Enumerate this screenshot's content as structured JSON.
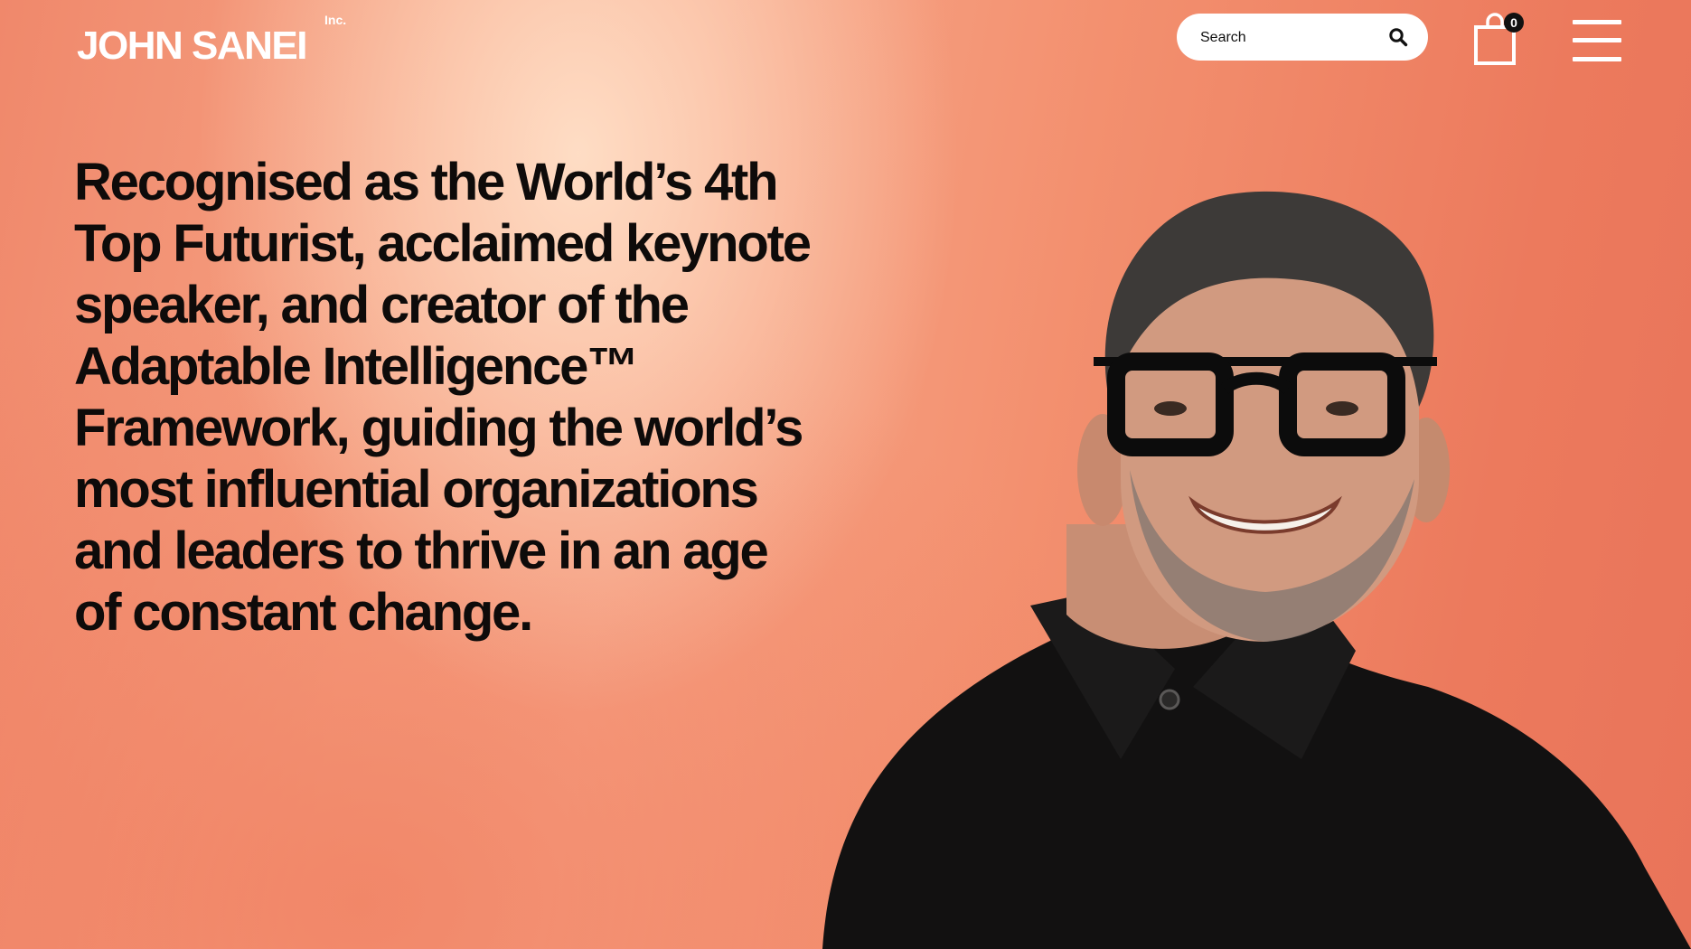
{
  "header": {
    "logo_name": "JOHN SANEI",
    "logo_suffix": "Inc.",
    "search_placeholder": "Search",
    "cart_count": "0"
  },
  "hero": {
    "headline": "Recognised as the World’s 4th\nTop Futurist, acclaimed keynote\nspeaker, and creator of the\nAdaptable Intelligence™\nFramework, guiding the world’s\nmost influential organizations\nand leaders to thrive in an age\nof constant change."
  },
  "colors": {
    "background_warm": "#f3906f",
    "background_light": "#fde0cc",
    "text_dark": "#0e0b0a",
    "white": "#ffffff"
  }
}
